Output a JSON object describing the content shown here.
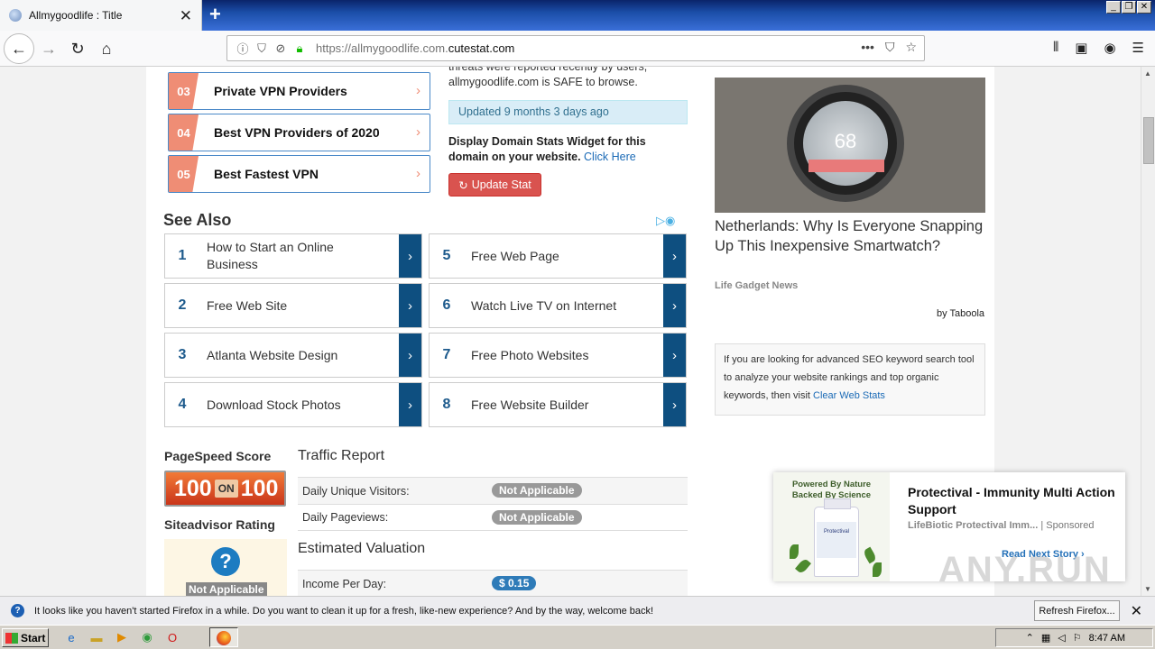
{
  "browser": {
    "tab_title": "Allmygoodlife : Title",
    "url_prefix": "https://allmygoodlife.com.",
    "url_domain": "cutestat.com"
  },
  "ad_list": [
    {
      "num": "03",
      "label": "Private VPN Providers"
    },
    {
      "num": "04",
      "label": "Best VPN Providers of 2020"
    },
    {
      "num": "05",
      "label": "Best Fastest VPN"
    }
  ],
  "safety": {
    "text": "threats were reported recently by users, allmygoodlife.com is SAFE to browse.",
    "updated": "Updated 9 months 3 days ago",
    "widget_text": "Display Domain Stats Widget for this domain on your website.",
    "widget_link": "Click Here",
    "update_button": "Update Stat"
  },
  "see_also": {
    "title": "See Also",
    "items": [
      {
        "num": "1",
        "label": "How to Start an Online Business"
      },
      {
        "num": "5",
        "label": "Free Web Page"
      },
      {
        "num": "2",
        "label": "Free Web Site"
      },
      {
        "num": "6",
        "label": "Watch Live TV on Internet"
      },
      {
        "num": "3",
        "label": "Atlanta Website Design"
      },
      {
        "num": "7",
        "label": "Free Photo Websites"
      },
      {
        "num": "4",
        "label": "Download Stock Photos"
      },
      {
        "num": "8",
        "label": "Free Website Builder"
      }
    ]
  },
  "pagespeed": {
    "title": "PageSpeed Score",
    "score": "100",
    "on": "ON",
    "max": "100"
  },
  "siteadvisor": {
    "title": "Siteadvisor Rating",
    "value": "Not Applicable"
  },
  "traffic": {
    "title": "Traffic Report",
    "rows": [
      {
        "label": "Daily Unique Visitors:",
        "value": "Not Applicable"
      },
      {
        "label": "Daily Pageviews:",
        "value": "Not Applicable"
      }
    ]
  },
  "valuation": {
    "title": "Estimated Valuation",
    "rows": [
      {
        "label": "Income Per Day:",
        "value": "$ 0.15"
      }
    ]
  },
  "sidebar": {
    "watch_bpm": "68",
    "headline": "Netherlands: Why Is Everyone Snapping Up This Inexpensive Smartwatch?",
    "source": "Life Gadget News",
    "by": "by Taboola",
    "seo_text": "If you are looking for advanced SEO keyword search tool to analyze your website rankings and top organic keywords, then visit",
    "seo_link": "Clear Web Stats"
  },
  "popup_ad": {
    "tagline1": "Powered By Nature",
    "tagline2": "Backed By Science",
    "product": "Protectival",
    "title": "Protectival - Immunity Multi Action Support",
    "source": "LifeBiotic Protectival Imm...",
    "sponsored": "Sponsored",
    "next": "Read Next Story"
  },
  "watermark": "ANY.RUN",
  "notification": {
    "text": "It looks like you haven't started Firefox in a while. Do you want to clean it up for a fresh, like-new experience? And by the way, welcome back!",
    "button": "Refresh Firefox..."
  },
  "taskbar": {
    "start": "Start",
    "time": "8:47 AM"
  }
}
